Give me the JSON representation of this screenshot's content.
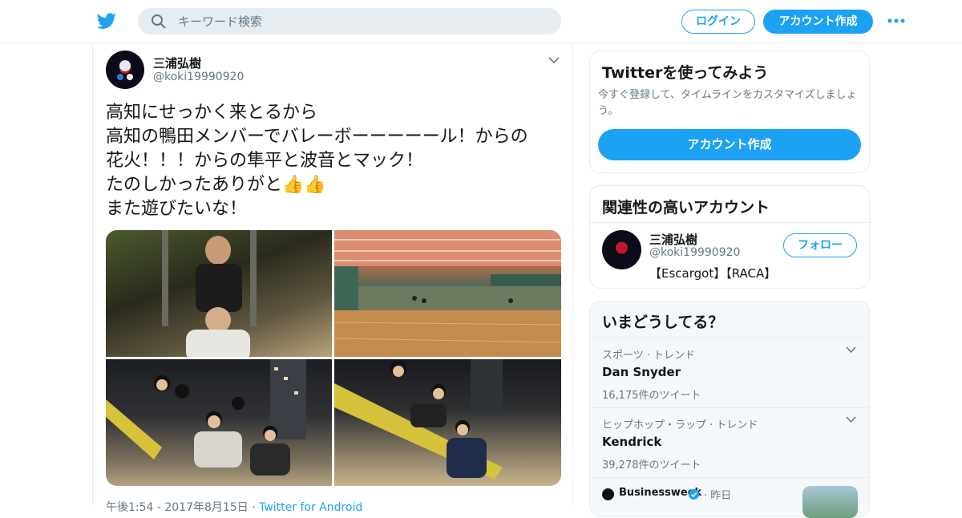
{
  "header": {
    "search_placeholder": "キーワード検索",
    "login_label": "ログイン",
    "signup_label": "アカウント作成",
    "logo_icon": "twitter-bird-icon",
    "more_icon": "more-dots-icon",
    "accent": "#1da1f2"
  },
  "tweet": {
    "user_name": "三浦弘樹",
    "handle": "@koki19990920",
    "text": "高知にせっかく来とるから\n高知の鴨田メンバーでバレーボーーーーール！からの\n花火！！！からの隼平と波音とマック！\nたのしかったありがと👍👍\nまた遊びたいな！",
    "images": [
      "photo-1",
      "photo-2",
      "photo-3",
      "photo-4"
    ],
    "timestamp": "午後1:54 - 2017年8月15日",
    "source": "Twitter for Android"
  },
  "sidebar": {
    "try_twitter": {
      "title": "Twitterを使ってみよう",
      "description": "今すぐ登録して、タイムラインをカスタマイズしましょう。",
      "cta_label": "アカウント作成"
    },
    "related": {
      "title": "関連性の高いアカウント",
      "name": "三浦弘樹",
      "handle": "@koki19990920",
      "bio": "【Escargot】【RACA】",
      "follow_label": "フォロー"
    },
    "trends": {
      "title": "いまどうしてる？",
      "items": [
        {
          "category": "スポーツ · トレンド",
          "name": "Dan Snyder",
          "count": "16,175件のツイート"
        },
        {
          "category": "ヒップホップ・ラップ · トレンド",
          "name": "Kendrick",
          "count": "39,278件のツイート"
        }
      ],
      "news": {
        "source": "Businessweek",
        "time": "· 昨日"
      }
    }
  }
}
